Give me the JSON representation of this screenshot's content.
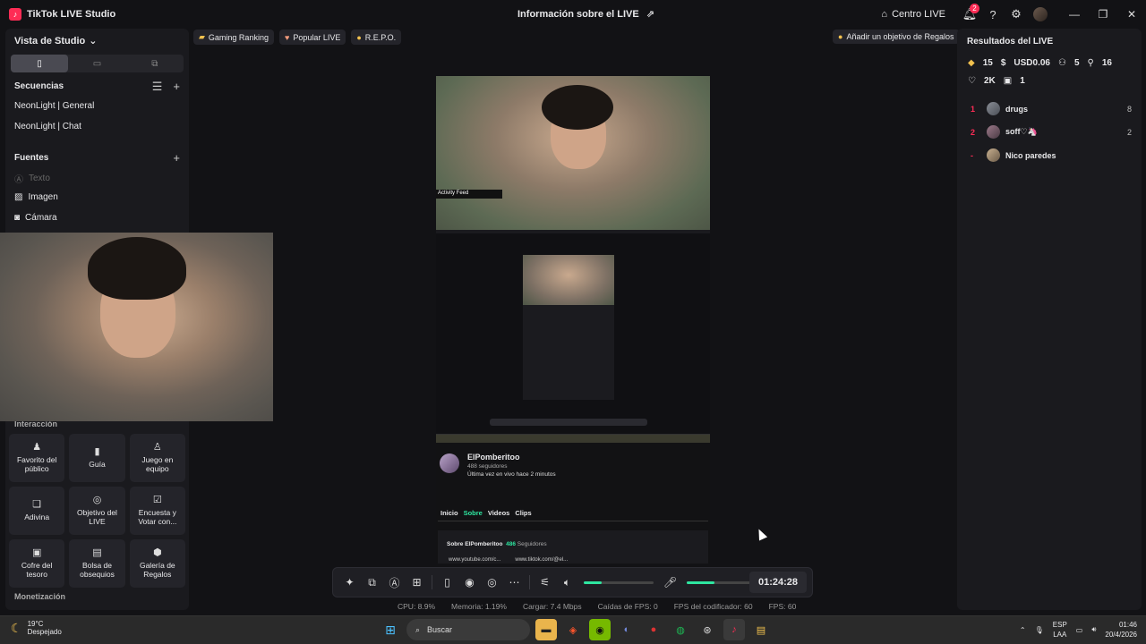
{
  "titlebar": {
    "app_name": "TikTok LIVE Studio",
    "center_title": "Información sobre el LIVE",
    "live_center_label": "Centro LIVE",
    "notification_count": "2"
  },
  "left": {
    "studio_view": "Vista de Studio",
    "sequences_heading": "Secuencias",
    "sequences": [
      "NeonLight | General",
      "NeonLight | Chat"
    ],
    "sources_heading": "Fuentes",
    "sources": [
      {
        "label": "Texto",
        "icon": "text-icon"
      },
      {
        "label": "Imagen",
        "icon": "image-icon"
      },
      {
        "label": "Cámara",
        "icon": "camera-icon"
      }
    ],
    "interaction_heading": "Interacción",
    "tiles": [
      {
        "label": "Favorito del público",
        "icon": "favorite-icon"
      },
      {
        "label": "Guía",
        "icon": "guide-icon"
      },
      {
        "label": "Juego en equipo",
        "icon": "team-game-icon"
      },
      {
        "label": "Adivina",
        "icon": "guess-icon"
      },
      {
        "label": "Objetivo del LIVE",
        "icon": "goal-icon"
      },
      {
        "label": "Encuesta y Votar con...",
        "icon": "poll-icon"
      },
      {
        "label": "Cofre del tesoro",
        "icon": "treasure-icon"
      },
      {
        "label": "Bolsa de obsequios",
        "icon": "gift-bag-icon"
      },
      {
        "label": "Galería de Regalos",
        "icon": "gift-gallery-icon"
      }
    ],
    "monetization_heading": "Monetización"
  },
  "center": {
    "tags": [
      {
        "label": "Gaming Ranking",
        "icon": "trophy-icon"
      },
      {
        "label": "Popular LIVE",
        "icon": "heart-icon"
      },
      {
        "label": "R.E.P.O.",
        "icon": "game-icon"
      }
    ],
    "add_goal": "Añadir un objetivo de Regalos",
    "activity_feed": "Activity Feed",
    "profile": {
      "name": "ElPomberitoo",
      "followers": "488 seguidores",
      "last_live": "Última vez en vivo hace 2 minutos",
      "tabs": [
        "Inicio",
        "Sobre",
        "Videos",
        "Clips"
      ],
      "active_tab": "Sobre",
      "about_title": "Sobre ElPomberitoo",
      "about_followers": "486",
      "about_followers_label": "Seguidores",
      "link1": "www.youtube.com/c...",
      "link2": "www.tiktok.com/@el..."
    },
    "timer": "01:24:28",
    "volume_level": 0.25,
    "mic_level": 0.4,
    "stats": {
      "cpu": "CPU:  8.9%",
      "memory": "Memoria:  1.19%",
      "upload": "Cargar:  7.4 Mbps",
      "fps_drops": "Caídas de FPS:  0",
      "encoder_fps": "FPS del codificador:  60",
      "fps": "FPS:  60"
    }
  },
  "right": {
    "title": "Resultados del LIVE",
    "diamonds": "15",
    "usd": "USD0.06",
    "viewers": "5",
    "new_followers": "16",
    "likes": "2K",
    "gifts": "1",
    "ranking": [
      {
        "rank": "1",
        "name": "drugs",
        "value": "8"
      },
      {
        "rank": "2",
        "name": "soff♡🦄",
        "value": "2"
      },
      {
        "rank": "-",
        "name": "Nico paredes",
        "value": ""
      }
    ]
  },
  "taskbar": {
    "temperature": "19°C",
    "condition": "Despejado",
    "search_placeholder": "Buscar",
    "lang_line1": "ESP",
    "lang_line2": "LAA",
    "time": "01:46",
    "date": "20/4/2026"
  },
  "colors": {
    "accent": "#fe2c55",
    "green": "#2ee6a0"
  }
}
